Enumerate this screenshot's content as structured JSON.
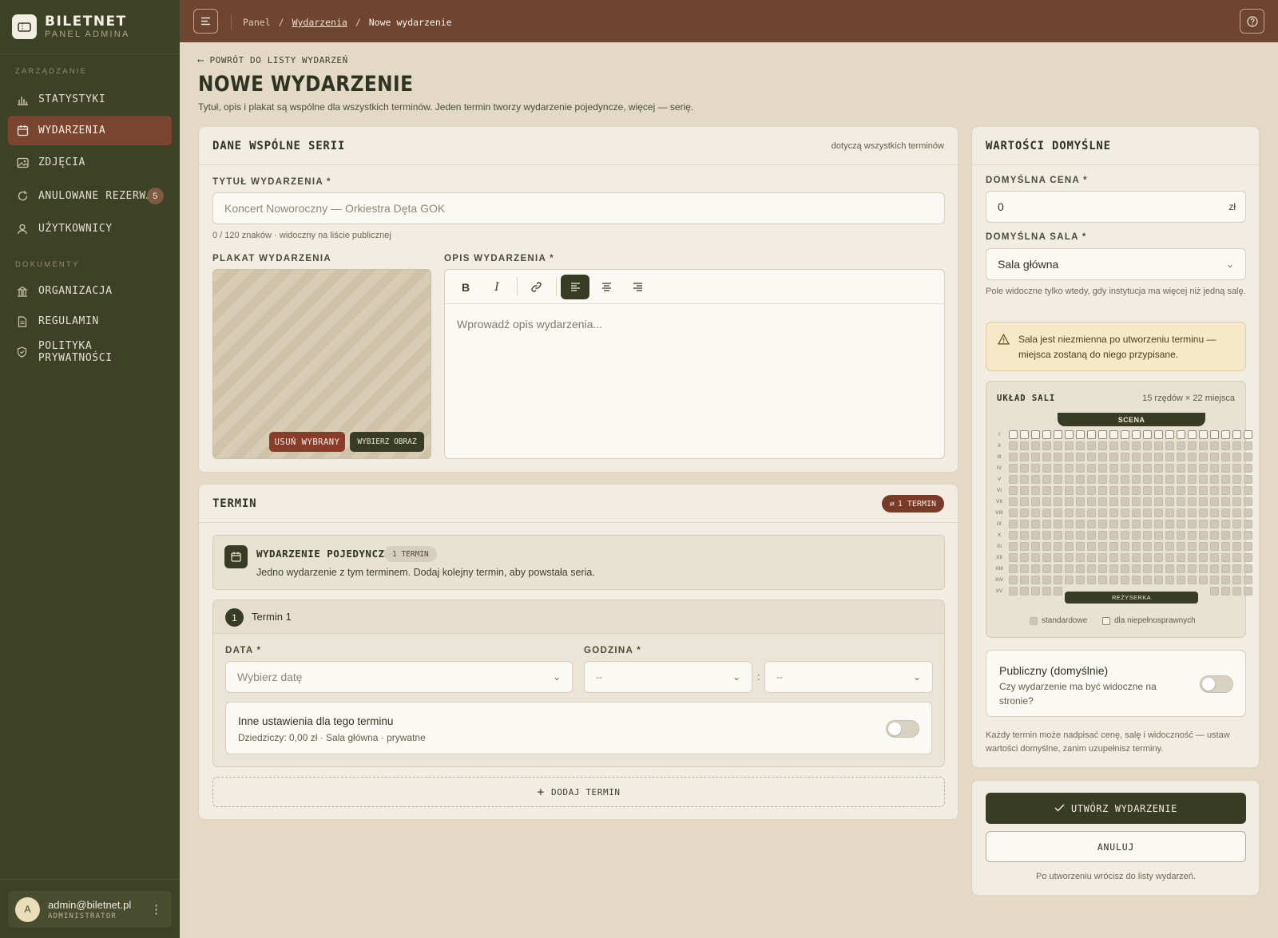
{
  "brand": {
    "title": "BILETNET",
    "subtitle": "PANEL ADMINA"
  },
  "sidebar": {
    "section_manage": "ZARZĄDZANIE",
    "section_docs": "DOKUMENTY",
    "items": [
      {
        "label": "STATYSTYKI",
        "icon": "bar-chart-icon"
      },
      {
        "label": "WYDARZENIA",
        "icon": "calendar-icon",
        "active": true
      },
      {
        "label": "ZDJĘCIA",
        "icon": "image-icon"
      },
      {
        "label": "ANULOWANE REZERW…",
        "icon": "refresh-icon",
        "badge": "5"
      },
      {
        "label": "UŻYTKOWNICY",
        "icon": "user-icon"
      }
    ],
    "doc_items": [
      {
        "label": "ORGANIZACJA",
        "icon": "building-icon"
      },
      {
        "label": "REGULAMIN",
        "icon": "document-icon"
      },
      {
        "label": "POLITYKA PRYWATNOŚCI",
        "icon": "shield-icon"
      }
    ],
    "user": {
      "initial": "A",
      "email": "admin@biletnet.pl",
      "role": "ADMINISTRATOR"
    }
  },
  "topbar": {
    "crumbs": [
      "Panel",
      "Wydarzenia",
      "Nowe wydarzenie"
    ],
    "separator": "/"
  },
  "header": {
    "back": "POWRÓT DO LISTY WYDARZEŃ",
    "title": "NOWE WYDARZENIE",
    "subtitle": "Tytuł, opis i plakat są wspólne dla wszystkich terminów. Jeden termin tworzy wydarzenie pojedyncze, więcej — serię."
  },
  "common": {
    "title": "DANE WSPÓLNE SERII",
    "note": "dotyczą wszystkich terminów",
    "event_title_label": "TYTUŁ WYDARZENIA *",
    "event_title_placeholder": "Koncert Noworoczny — Orkiestra Dęta GOK",
    "event_title_hint": "0 / 120 znaków · widoczny na liście publicznej",
    "poster_label": "PLAKAT WYDARZENIA",
    "poster_remove": "USUŃ WYBRANY",
    "poster_choose": "WYBIERZ OBRAZ",
    "desc_label": "OPIS WYDARZENIA *",
    "desc_placeholder": "Wprowadź opis wydarzenia...",
    "toolbar": {
      "bold": "B",
      "italic": "I"
    }
  },
  "term": {
    "title": "TERMIN",
    "count_pill": "1 TERMIN",
    "single_title": "WYDARZENIE POJEDYNCZE",
    "single_tag": "1 TERMIN",
    "single_desc": "Jedno wydarzenie z tym terminem. Dodaj kolejny termin, aby powstała seria.",
    "term_number": "1",
    "term_name": "Termin 1",
    "date_label": "DATA *",
    "date_placeholder": "Wybierz datę",
    "hour_label": "GODZINA *",
    "hour_placeholder": "--",
    "minute_placeholder": "--",
    "time_sep": ":",
    "other_title": "Inne ustawienia dla tego terminu",
    "other_sub": "Dziedziczy: 0,00 zł · Sala główna · prywatne",
    "other_enabled": false,
    "add_term": "DODAJ TERMIN"
  },
  "defaults": {
    "title": "WARTOŚCI DOMYŚLNE",
    "price_label": "DOMYŚLNA CENA *",
    "price_value": "0",
    "price_unit": "zł",
    "hall_label": "DOMYŚLNA SALA *",
    "hall_value": "Sala główna",
    "hall_hint": "Pole widoczne tylko wtedy, gdy instytucja ma więcej niż jedną salę.",
    "warning": "Sala jest niezmienna po utworzeniu terminu — miejsca zostaną do niego przypisane.",
    "layout_title": "UKŁAD SALI",
    "layout_dims": "15 rzędów × 22 miejsca",
    "stage": "SCENA",
    "director": "REŻYSERKA",
    "rows": [
      "I",
      "II",
      "III",
      "IV",
      "V",
      "VI",
      "VII",
      "VIII",
      "IX",
      "X",
      "XI",
      "XII",
      "XIII",
      "XIV",
      "XV"
    ],
    "legend_standard": "standardowe",
    "legend_accessible": "dla niepełnosprawnych",
    "public_title": "Publiczny (domyślnie)",
    "public_sub": "Czy wydarzenie ma być widoczne na stronie?",
    "public_enabled": false,
    "footer_hint": "Każdy termin może nadpisać cenę, salę i widoczność — ustaw wartości domyślne, zanim uzupełnisz terminy."
  },
  "actions": {
    "create": "UTWÓRZ WYDARZENIE",
    "cancel": "ANULUJ",
    "hint": "Po utworzeniu wrócisz do listy wydarzeń."
  },
  "colors": {
    "sidebar": "#3d4226",
    "topbar": "#6d4531",
    "accent": "#7a4530",
    "primary_dark": "#383c24",
    "background": "#e3d9c5"
  }
}
